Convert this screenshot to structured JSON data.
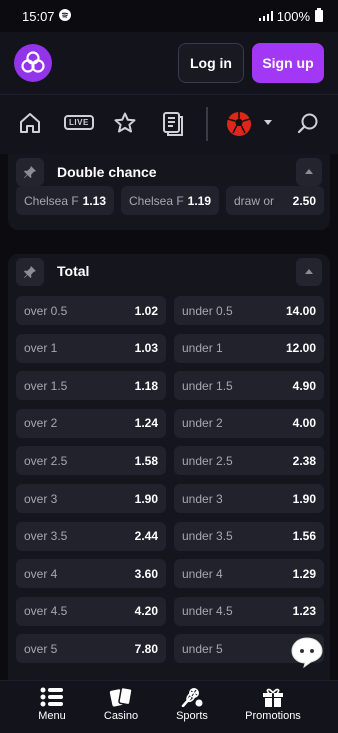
{
  "status_bar": {
    "time": "15:07",
    "battery": "100%"
  },
  "header": {
    "login_label": "Log in",
    "signup_label": "Sign up"
  },
  "nav": {
    "live_label": "LIVE"
  },
  "double_chance": {
    "title": "Double chance",
    "odds": [
      {
        "label": "Chelsea F",
        "value": "1.13"
      },
      {
        "label": "Chelsea F",
        "value": "1.19"
      },
      {
        "label": "draw or",
        "value": "2.50"
      }
    ]
  },
  "total": {
    "title": "Total",
    "rows": [
      {
        "over_label": "over 0.5",
        "over_value": "1.02",
        "under_label": "under 0.5",
        "under_value": "14.00"
      },
      {
        "over_label": "over 1",
        "over_value": "1.03",
        "under_label": "under 1",
        "under_value": "12.00"
      },
      {
        "over_label": "over 1.5",
        "over_value": "1.18",
        "under_label": "under 1.5",
        "under_value": "4.90"
      },
      {
        "over_label": "over 2",
        "over_value": "1.24",
        "under_label": "under 2",
        "under_value": "4.00"
      },
      {
        "over_label": "over 2.5",
        "over_value": "1.58",
        "under_label": "under 2.5",
        "under_value": "2.38"
      },
      {
        "over_label": "over 3",
        "over_value": "1.90",
        "under_label": "under 3",
        "under_value": "1.90"
      },
      {
        "over_label": "over 3.5",
        "over_value": "2.44",
        "under_label": "under 3.5",
        "under_value": "1.56"
      },
      {
        "over_label": "over 4",
        "over_value": "3.60",
        "under_label": "under 4",
        "under_value": "1.29"
      },
      {
        "over_label": "over 4.5",
        "over_value": "4.20",
        "under_label": "under 4.5",
        "under_value": "1.23"
      },
      {
        "over_label": "over 5",
        "over_value": "7.80",
        "under_label": "under 5",
        "under_value": ""
      }
    ]
  },
  "bottom_nav": [
    {
      "label": "Menu",
      "icon": "menu-icon"
    },
    {
      "label": "Casino",
      "icon": "cards-icon"
    },
    {
      "label": "Sports",
      "icon": "sports-icon"
    },
    {
      "label": "Promotions",
      "icon": "gift-icon"
    }
  ],
  "colors": {
    "accent": "#a238f5",
    "background": "#0b0b10",
    "card": "#15151d",
    "odd_cell": "#22222d"
  }
}
